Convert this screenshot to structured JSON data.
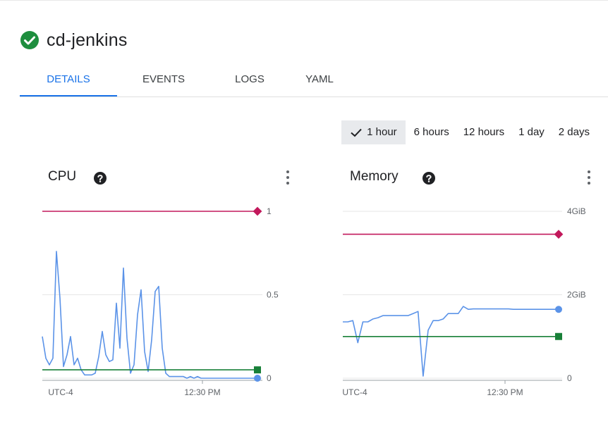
{
  "header": {
    "title": "cd-jenkins",
    "status": "ok",
    "status_color": "#1e8e3e"
  },
  "tabs": [
    {
      "label": "DETAILS",
      "active": true
    },
    {
      "label": "EVENTS",
      "active": false
    },
    {
      "label": "LOGS",
      "active": false
    },
    {
      "label": "YAML",
      "active": false
    }
  ],
  "time_ranges": {
    "selected": "1 hour",
    "options": [
      "1 hour",
      "6 hours",
      "12 hours",
      "1 day",
      "2 days"
    ]
  },
  "colors": {
    "accent": "#1a73e8",
    "usage": "#5b93e8",
    "limit": "#c2185b",
    "request": "#188038",
    "grid": "#e6e6e6"
  },
  "cards": [
    {
      "title": "CPU",
      "help_icon": "help-circle-icon",
      "menu_icon": "more-vert-icon"
    },
    {
      "title": "Memory",
      "help_icon": "help-circle-icon",
      "menu_icon": "more-vert-icon"
    }
  ],
  "chart_data": [
    {
      "type": "line",
      "title": "CPU",
      "x_tick_labels": [
        "UTC-4",
        "12:30 PM"
      ],
      "y_tick_labels": [
        "1",
        "0.5",
        "0"
      ],
      "ylim": [
        0,
        1
      ],
      "grid": true,
      "series": [
        {
          "role": "usage",
          "values": [
            0.25,
            0.12,
            0.08,
            0.12,
            0.76,
            0.48,
            0.07,
            0.14,
            0.25,
            0.08,
            0.12,
            0.05,
            0.02,
            0.02,
            0.02,
            0.03,
            0.13,
            0.28,
            0.14,
            0.1,
            0.11,
            0.45,
            0.18,
            0.66,
            0.24,
            0.03,
            0.08,
            0.38,
            0.53,
            0.16,
            0.04,
            0.23,
            0.52,
            0.55,
            0.18,
            0.03,
            0.01,
            0.01,
            0.01,
            0.01,
            0.01,
            0.0,
            0.01,
            0.0,
            0.01,
            0.0,
            0.0,
            0.0,
            0.0,
            0.0,
            0.0,
            0.0,
            0.0,
            0.0,
            0.0,
            0.0,
            0.0,
            0.0,
            0.0,
            0.0,
            0.0,
            0.0
          ]
        },
        {
          "role": "limit",
          "values": [
            1.0,
            1.0
          ]
        },
        {
          "role": "request",
          "values": [
            0.05,
            0.05
          ]
        }
      ]
    },
    {
      "type": "line",
      "title": "Memory",
      "x_tick_labels": [
        "UTC-4",
        "12:30 PM"
      ],
      "y_tick_labels": [
        "4GiB",
        "2GiB",
        "0"
      ],
      "ylim": [
        0,
        4
      ],
      "grid": true,
      "series": [
        {
          "role": "usage",
          "values": [
            1.35,
            1.35,
            1.38,
            0.85,
            1.35,
            1.35,
            1.42,
            1.45,
            1.5,
            1.5,
            1.5,
            1.5,
            1.5,
            1.5,
            1.55,
            1.6,
            0.05,
            1.15,
            1.38,
            1.38,
            1.42,
            1.55,
            1.55,
            1.55,
            1.72,
            1.65,
            1.66,
            1.66,
            1.66,
            1.66,
            1.66,
            1.66,
            1.66,
            1.66,
            1.65,
            1.65,
            1.65,
            1.65,
            1.65,
            1.65,
            1.65,
            1.65,
            1.65,
            1.65
          ]
        },
        {
          "role": "limit",
          "values": [
            3.45,
            3.45
          ]
        },
        {
          "role": "request",
          "values": [
            1.0,
            1.0
          ]
        }
      ]
    }
  ]
}
